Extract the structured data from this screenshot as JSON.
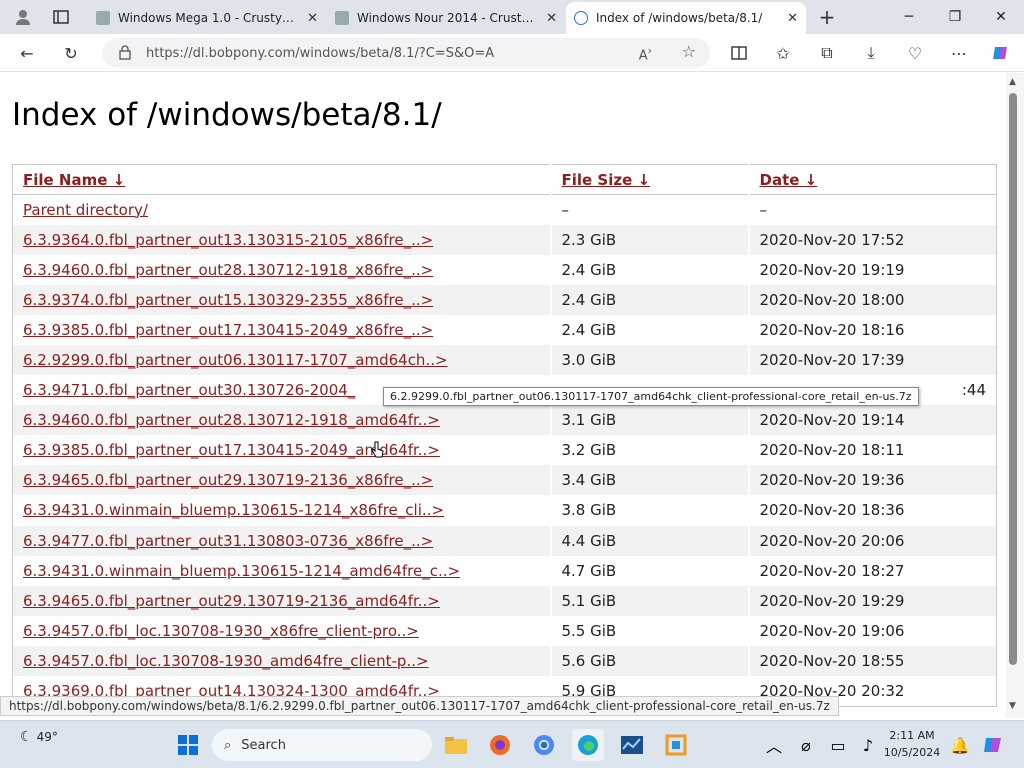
{
  "browser": {
    "tabs": [
      {
        "title": "Windows Mega 1.0 - CrustyWind",
        "icon": "crustywindows-favicon"
      },
      {
        "title": "Windows Nour 2014 - CrustyWin",
        "icon": "crustywindows-favicon"
      },
      {
        "title": "Index of /windows/beta/8.1/",
        "icon": "edge-favicon",
        "active": true
      }
    ],
    "url": "https://dl.bobpony.com/windows/beta/8.1/?C=S&O=A"
  },
  "page": {
    "heading": "Index of /windows/beta/8.1/",
    "columns": [
      {
        "label": "File Name",
        "sort": "↓"
      },
      {
        "label": "File Size",
        "sort": "↓"
      },
      {
        "label": "Date",
        "sort": "↓"
      }
    ],
    "rows": [
      {
        "name": "Parent directory/",
        "size": "–",
        "date": "–"
      },
      {
        "name": "6.3.9364.0.fbl_partner_out13.130315-2105_x86fre_..>",
        "size": "2.3 GiB",
        "date": "2020-Nov-20 17:52"
      },
      {
        "name": "6.3.9460.0.fbl_partner_out28.130712-1918_x86fre_..>",
        "size": "2.4 GiB",
        "date": "2020-Nov-20 19:19"
      },
      {
        "name": "6.3.9374.0.fbl_partner_out15.130329-2355_x86fre_..>",
        "size": "2.4 GiB",
        "date": "2020-Nov-20 18:00"
      },
      {
        "name": "6.3.9385.0.fbl_partner_out17.130415-2049_x86fre_..>",
        "size": "2.4 GiB",
        "date": "2020-Nov-20 18:16"
      },
      {
        "name": "6.2.9299.0.fbl_partner_out06.130117-1707_amd64ch..>",
        "size": "3.0 GiB",
        "date": "2020-Nov-20 17:39"
      },
      {
        "name": "6.3.9471.0.fbl_partner_out30.130726-2004_",
        "size": "",
        "date": ":44"
      },
      {
        "name": "6.3.9460.0.fbl_partner_out28.130712-1918_amd64fr..>",
        "size": "3.1 GiB",
        "date": "2020-Nov-20 19:14"
      },
      {
        "name": "6.3.9385.0.fbl_partner_out17.130415-2049_amd64fr..>",
        "size": "3.2 GiB",
        "date": "2020-Nov-20 18:11"
      },
      {
        "name": "6.3.9465.0.fbl_partner_out29.130719-2136_x86fre_..>",
        "size": "3.4 GiB",
        "date": "2020-Nov-20 19:36"
      },
      {
        "name": "6.3.9431.0.winmain_bluemp.130615-1214_x86fre_cli..>",
        "size": "3.8 GiB",
        "date": "2020-Nov-20 18:36"
      },
      {
        "name": "6.3.9477.0.fbl_partner_out31.130803-0736_x86fre_..>",
        "size": "4.4 GiB",
        "date": "2020-Nov-20 20:06"
      },
      {
        "name": "6.3.9431.0.winmain_bluemp.130615-1214_amd64fre_c..>",
        "size": "4.7 GiB",
        "date": "2020-Nov-20 18:27"
      },
      {
        "name": "6.3.9465.0.fbl_partner_out29.130719-2136_amd64fr..>",
        "size": "5.1 GiB",
        "date": "2020-Nov-20 19:29"
      },
      {
        "name": "6.3.9457.0.fbl_loc.130708-1930_x86fre_client-pro..>",
        "size": "5.5 GiB",
        "date": "2020-Nov-20 19:06"
      },
      {
        "name": "6.3.9457.0.fbl_loc.130708-1930_amd64fre_client-p..>",
        "size": "5.6 GiB",
        "date": "2020-Nov-20 18:55"
      },
      {
        "name": "6.3.9369.0.fbl_partner_out14.130324-1300_amd64fr..>",
        "size": "5.9 GiB",
        "date": "2020-Nov-20 20:32"
      }
    ],
    "tooltip": "6.2.9299.0.fbl_partner_out06.130117-1707_amd64chk_client-professional-core_retail_en-us.7z",
    "status_url": "https://dl.bobpony.com/windows/beta/8.1/6.2.9299.0.fbl_partner_out06.130117-1707_amd64chk_client-professional-core_retail_en-us.7z"
  },
  "taskbar": {
    "weather": "49°",
    "search_placeholder": "Search",
    "time": "2:11 AM",
    "date": "10/5/2024"
  },
  "colors": {
    "link": "#8b1e1e",
    "row_alt": "#f2f2f2",
    "taskbar": "#dce4ee"
  }
}
